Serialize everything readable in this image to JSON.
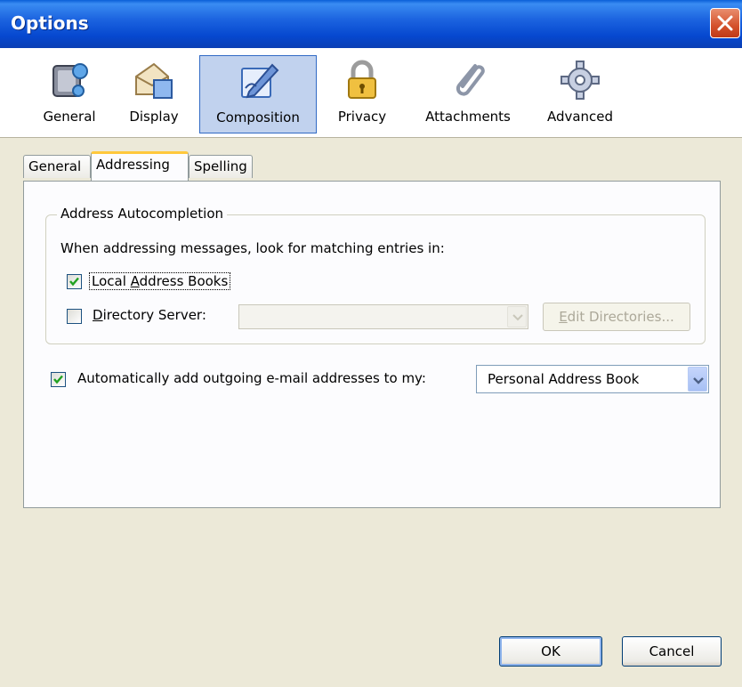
{
  "window": {
    "title": "Options"
  },
  "toolbar": {
    "items": [
      {
        "label": "General",
        "icon": "general-icon",
        "selected": false
      },
      {
        "label": "Display",
        "icon": "display-icon",
        "selected": false
      },
      {
        "label": "Composition",
        "icon": "composition-icon",
        "selected": true
      },
      {
        "label": "Privacy",
        "icon": "lock-icon",
        "selected": false
      },
      {
        "label": "Attachments",
        "icon": "paperclip-icon",
        "selected": false
      },
      {
        "label": "Advanced",
        "icon": "gear-icon",
        "selected": false
      }
    ]
  },
  "tabs": [
    {
      "label": "General",
      "active": false
    },
    {
      "label": "Addressing",
      "active": true
    },
    {
      "label": "Spelling",
      "active": false
    }
  ],
  "autocompletion": {
    "legend": "Address Autocompletion",
    "description": "When addressing messages, look for matching entries in:",
    "local_address_books": {
      "label_pre": "Local ",
      "label_accel": "A",
      "label_post": "ddress Books",
      "checked": true
    },
    "directory_server": {
      "label_accel": "D",
      "label_post": "irectory Server:",
      "checked": false,
      "value": ""
    },
    "edit_directories": {
      "label_accel": "E",
      "label_post": "dit Directories..."
    }
  },
  "auto_add": {
    "label": "Automatically add outgoing e-mail addresses to my:",
    "checked": true,
    "selected_book": "Personal Address Book"
  },
  "buttons": {
    "ok": "OK",
    "cancel": "Cancel"
  },
  "colors": {
    "titlebar": "#0a5fd8",
    "dialog_bg": "#ece9d8",
    "selection": "#c1d2ee",
    "tab_highlight": "#ffc83c"
  }
}
